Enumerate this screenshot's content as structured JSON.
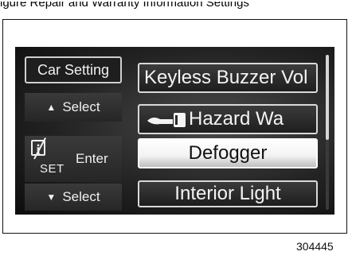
{
  "caption_top": "igure Repair and Warranty Information Settings",
  "sidebar": {
    "car_setting": "Car Setting",
    "select_up": "Select",
    "enter": "Enter",
    "info_set_label": "SET",
    "info_i_label": "i",
    "select_down": "Select"
  },
  "menu": {
    "items": [
      {
        "label": "Keyless Buzzer Vol",
        "selected": false
      },
      {
        "label": "Hazard Wa",
        "selected": false,
        "icon": "key-icon"
      },
      {
        "label": "Defogger",
        "selected": true
      },
      {
        "label": "Interior Light",
        "selected": false
      }
    ]
  },
  "scroll": {
    "position_fraction": 0.0,
    "visible_fraction": 0.55
  },
  "figure_number": "304445",
  "colors": {
    "screen_bg": "#232323",
    "selected_bg": "#f2f2f2",
    "border": "#d9d9d9"
  }
}
